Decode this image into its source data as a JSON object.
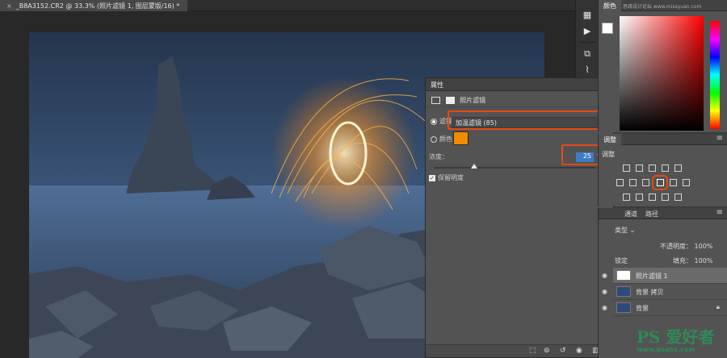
{
  "document": {
    "close_glyph": "×",
    "tab_title": "_B8A3152.CR2 @ 33.3% (照片滤镜 1, 图层蒙版/16) *"
  },
  "toolbar": {
    "icons": [
      "history-icon",
      "play-icon",
      "layer-comps-icon",
      "glyph-icon",
      "paragraph-icon",
      "character-icon"
    ]
  },
  "properties_panel": {
    "tab_label": "属性",
    "adjustment_title": "照片滤镜",
    "filter_label": "滤镜：",
    "filter_value": "加温滤镜 (85)",
    "color_label": "颜色：",
    "color_value": "#f08c00",
    "density_label": "浓度：",
    "density_value": "25",
    "density_unit": "%",
    "density_slider_percent": 25,
    "preserve_luminosity_label": "保留明度",
    "preserve_luminosity_checked": true
  },
  "color_panel": {
    "tab_label": "颜色",
    "watermark_text": "思缘设计论坛 www.missyuan.com"
  },
  "adjustments_panel": {
    "tab_label": "调整",
    "add_label": "调整"
  },
  "layers_panel": {
    "tabs": [
      "通道",
      "路径"
    ],
    "kind_label": "类型",
    "mode_label": "不透明度：",
    "opacity": "100%",
    "lock_label": "锁定",
    "fill_label": "填充：",
    "fill": "100%",
    "layers": [
      {
        "name": "照片滤镜 1",
        "type": "adjustment"
      },
      {
        "name": "背景 拷贝",
        "type": "image"
      },
      {
        "name": "背景",
        "type": "image",
        "locked": true
      }
    ]
  },
  "watermark": {
    "logo": "PS 爱好者",
    "url": "www.psahz.com"
  },
  "colors": {
    "highlight": "#e64a12",
    "swatch": "#f08c00"
  }
}
